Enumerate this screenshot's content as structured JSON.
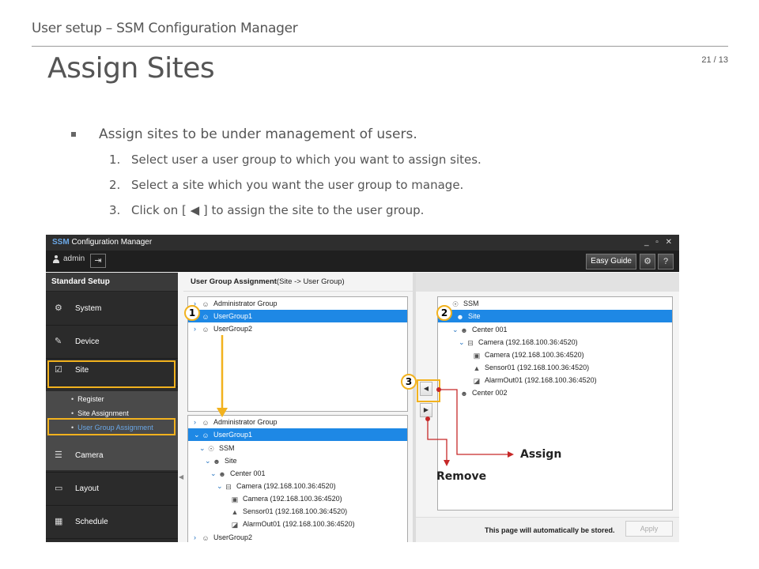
{
  "slide": {
    "header": "User setup – SSM Configuration Manager",
    "title": "Assign Sites",
    "page_number": "21 / 13",
    "bullet": "Assign sites to be under management of users.",
    "steps": [
      {
        "num": "1.",
        "text": "Select user a user group to which you want to assign sites."
      },
      {
        "num": "2.",
        "text": "Select a site which you want the user group to manage."
      },
      {
        "num": "3.",
        "text": "Click on [ ◀ ] to assign the site to the user group."
      }
    ]
  },
  "app": {
    "title_brand": "SSM",
    "title_rest": " Configuration Manager",
    "window_controls": "_ ▫ ✕",
    "user": "admin",
    "logout_icon": "⇥",
    "easy_guide": "Easy Guide",
    "gear_icon": "⚙",
    "help_icon": "?",
    "sidebar": {
      "heading": "Standard Setup",
      "items": [
        {
          "label": "System",
          "icon": "⚙"
        },
        {
          "label": "Device",
          "icon": "✎"
        },
        {
          "label": "Site",
          "icon": "☑"
        },
        {
          "label": "Camera",
          "icon": "☰"
        },
        {
          "label": "Layout",
          "icon": "▭"
        },
        {
          "label": "Schedule",
          "icon": "▦"
        }
      ],
      "submenu": [
        "Register",
        "Site Assignment",
        "User Group Assignment"
      ]
    },
    "content_head_bold": "User Group Assignment",
    "content_head_rest": "(Site -> User Group)",
    "top_tree": [
      {
        "label": "Administrator Group",
        "twisty": "›",
        "icon": "👥"
      },
      {
        "label": "UserGroup1",
        "twisty": "",
        "icon": "👥"
      },
      {
        "label": "UserGroup2",
        "twisty": "›",
        "icon": "👥"
      }
    ],
    "bottom_tree": [
      {
        "label": "Administrator Group",
        "twisty": "›",
        "icon": "👥"
      },
      {
        "label": "UserGroup1",
        "twisty": "⌄",
        "icon": "👥"
      },
      {
        "label": "SSM",
        "twisty": "⌄",
        "icon": "⚲"
      },
      {
        "label": "Site",
        "twisty": "⌄",
        "icon": "👤"
      },
      {
        "label": "Center 001",
        "twisty": "⌄",
        "icon": "👤"
      },
      {
        "label": "Camera (192.168.100.36:4520)",
        "twisty": "⌄",
        "icon": "⊟"
      },
      {
        "label": "Camera (192.168.100.36:4520)",
        "twisty": "",
        "icon": "▣"
      },
      {
        "label": "Sensor01 (192.168.100.36:4520)",
        "twisty": "",
        "icon": "▲"
      },
      {
        "label": "AlarmOut01 (192.168.100.36:4520)",
        "twisty": "",
        "icon": "◪"
      },
      {
        "label": "UserGroup2",
        "twisty": "›",
        "icon": "👥"
      }
    ],
    "right_tree": [
      {
        "label": "SSM",
        "twisty": "",
        "icon": "⚲"
      },
      {
        "label": "Site",
        "twisty": "",
        "icon": "👤"
      },
      {
        "label": "Center 001",
        "twisty": "⌄",
        "icon": "👤"
      },
      {
        "label": "Camera (192.168.100.36:4520)",
        "twisty": "⌄",
        "icon": "⊟"
      },
      {
        "label": "Camera (192.168.100.36:4520)",
        "twisty": "",
        "icon": "▣"
      },
      {
        "label": "Sensor01 (192.168.100.36:4520)",
        "twisty": "",
        "icon": "▲"
      },
      {
        "label": "AlarmOut01 (192.168.100.36:4520)",
        "twisty": "",
        "icon": "◪"
      },
      {
        "label": "Center 002",
        "twisty": "",
        "icon": "👤"
      }
    ],
    "assign_arrow": "◀",
    "remove_arrow": "▶",
    "auto_store": "This page will automatically be stored.",
    "apply": "Apply"
  },
  "annotations": {
    "badge1": "1",
    "badge2": "2",
    "badge3": "3",
    "assign": "Assign",
    "remove": "Remove"
  },
  "colors": {
    "highlight": "#f2b21e",
    "selection": "#1e88e5",
    "callout_line": "#c62828"
  }
}
